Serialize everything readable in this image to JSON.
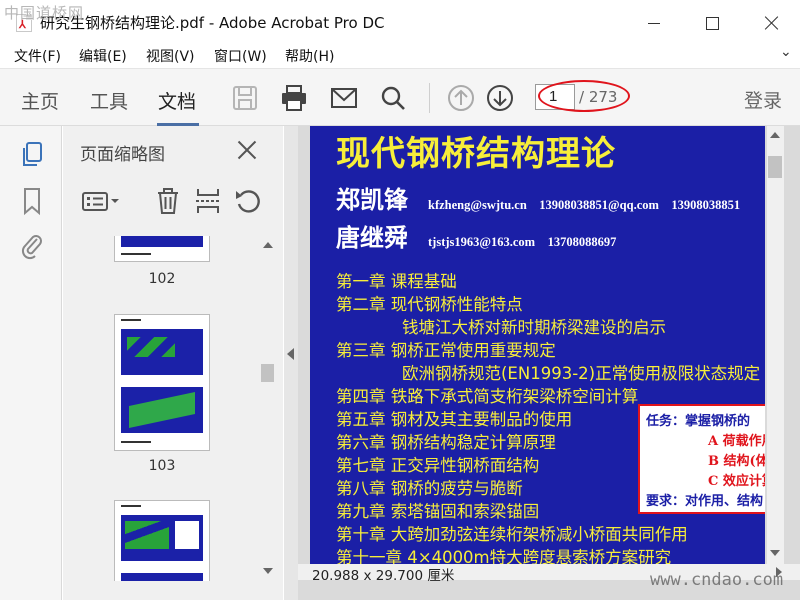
{
  "window": {
    "title": "研究生钢桥结构理论.pdf - Adobe Acrobat Pro DC",
    "watermark_top": "中国道桥网",
    "watermark_bottom": "www.cndao.com"
  },
  "menu": [
    {
      "label": "文件(F)"
    },
    {
      "label": "编辑(E)"
    },
    {
      "label": "视图(V)"
    },
    {
      "label": "窗口(W)"
    },
    {
      "label": "帮助(H)"
    }
  ],
  "toolbar": {
    "tabs": [
      {
        "label": "主页"
      },
      {
        "label": "工具"
      },
      {
        "label": "文档"
      }
    ],
    "active_tab": "文档",
    "icons": [
      "save-icon",
      "print-icon",
      "email-icon",
      "search-icon",
      "previous-page-icon",
      "next-page-icon"
    ],
    "page_current": "1",
    "page_total": "/ 273",
    "login_label": "登录",
    "accent_color": "#4a6fa5",
    "highlight_color": "#e0141c"
  },
  "left_rail": {
    "icons": [
      "page-thumbnails-icon",
      "bookmarks-icon",
      "attachments-icon"
    ]
  },
  "thumbnail_panel": {
    "title": "页面缩略图",
    "tools": [
      "thumbnail-options-icon",
      "delete-page-icon",
      "insert-page-icon",
      "rotate-page-icon"
    ],
    "pages": [
      {
        "number": "102"
      },
      {
        "number": "103"
      },
      {
        "number": ""
      }
    ]
  },
  "document": {
    "background_color": "#1b1fa6",
    "title_color": "#f7ee3a",
    "title": "现代钢桥结构理论",
    "authors": [
      {
        "name": "郑凯锋",
        "contact": "kfzheng@swjtu.cn　13908038851@qq.com　13908038851"
      },
      {
        "name": "唐继舜",
        "contact": "tjstjs1963@163.com　13708088697"
      }
    ],
    "chapters": [
      {
        "text": "第一章  课程基础",
        "sub": false
      },
      {
        "text": "第二章  现代钢桥性能特点",
        "sub": false
      },
      {
        "text": "钱塘江大桥对新时期桥梁建设的启示",
        "sub": true
      },
      {
        "text": "第三章  钢桥正常使用重要规定",
        "sub": false
      },
      {
        "text": "欧洲钢桥规范(EN1993-2)正常使用极限状态规定",
        "sub": true
      },
      {
        "text": "第四章  铁路下承式简支桁架梁桥空间计算",
        "sub": false
      },
      {
        "text": "第五章  钢材及其主要制品的使用",
        "sub": false
      },
      {
        "text": "第六章  钢桥结构稳定计算原理",
        "sub": false
      },
      {
        "text": "第七章  正交异性钢桥面结构",
        "sub": false
      },
      {
        "text": "第八章  钢桥的疲劳与脆断",
        "sub": false
      },
      {
        "text": "第九章  索塔锚固和索梁锚固",
        "sub": false
      },
      {
        "text": "第十章  大跨加劲弦连续桁架桥减小桥面共同作用",
        "sub": false
      },
      {
        "text": "第十一章  4×4000m特大跨度悬索桥方案研究",
        "sub": false
      }
    ],
    "task_box": {
      "line1": "任务：掌握钢桥的",
      "line2": "A  荷载作用",
      "line3": "B  结构(体系)",
      "line4": "C  效应计算",
      "line5": "要求：对作用、结构"
    }
  },
  "status": {
    "page_size": "20.988 x 29.700 厘米"
  }
}
